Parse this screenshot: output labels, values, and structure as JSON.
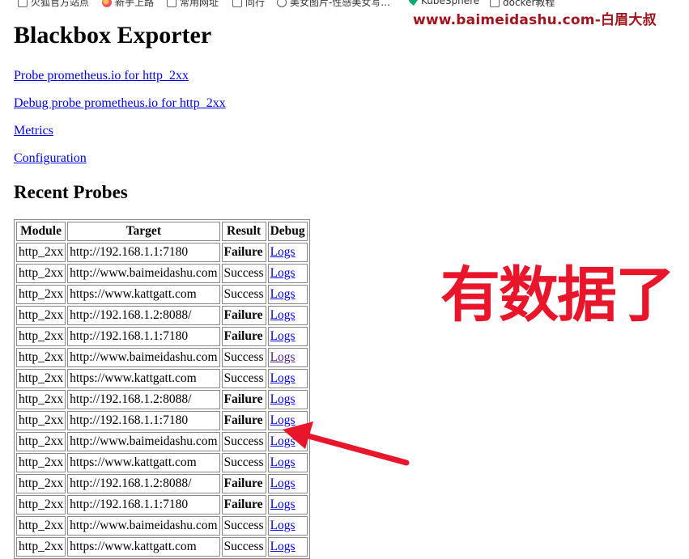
{
  "bookmarks": [
    {
      "label": "火狐官方站点",
      "icon": "bookmark-icon"
    },
    {
      "label": "新手上路",
      "icon": "firefox-icon"
    },
    {
      "label": "常用网址",
      "icon": "bookmark-icon"
    },
    {
      "label": "同行",
      "icon": "bookmark-icon"
    },
    {
      "label": "美女图片-性感美女写...",
      "icon": "globe-icon"
    },
    {
      "label": "KubeSphere",
      "icon": "kubesphere-icon"
    },
    {
      "label": "docker教程",
      "icon": "bookmark-icon"
    }
  ],
  "watermark": "www.baimeidashu.com-白眉大叔",
  "page": {
    "title": "Blackbox Exporter",
    "links": [
      "Probe prometheus.io for http_2xx",
      "Debug probe prometheus.io for http_2xx",
      "Metrics",
      "Configuration"
    ],
    "section_title": "Recent Probes"
  },
  "table": {
    "headers": [
      "Module",
      "Target",
      "Result",
      "Debug"
    ],
    "rows": [
      {
        "module": "http_2xx",
        "target": "http://192.168.1.1:7180",
        "result": "Failure",
        "debug": "Logs"
      },
      {
        "module": "http_2xx",
        "target": "http://www.baimeidashu.com",
        "result": "Success",
        "debug": "Logs"
      },
      {
        "module": "http_2xx",
        "target": "https://www.kattgatt.com",
        "result": "Success",
        "debug": "Logs"
      },
      {
        "module": "http_2xx",
        "target": "http://192.168.1.2:8088/",
        "result": "Failure",
        "debug": "Logs"
      },
      {
        "module": "http_2xx",
        "target": "http://192.168.1.1:7180",
        "result": "Failure",
        "debug": "Logs"
      },
      {
        "module": "http_2xx",
        "target": "http://www.baimeidashu.com",
        "result": "Success",
        "debug": "Logs",
        "visited": true
      },
      {
        "module": "http_2xx",
        "target": "https://www.kattgatt.com",
        "result": "Success",
        "debug": "Logs"
      },
      {
        "module": "http_2xx",
        "target": "http://192.168.1.2:8088/",
        "result": "Failure",
        "debug": "Logs"
      },
      {
        "module": "http_2xx",
        "target": "http://192.168.1.1:7180",
        "result": "Failure",
        "debug": "Logs"
      },
      {
        "module": "http_2xx",
        "target": "http://www.baimeidashu.com",
        "result": "Success",
        "debug": "Logs"
      },
      {
        "module": "http_2xx",
        "target": "https://www.kattgatt.com",
        "result": "Success",
        "debug": "Logs"
      },
      {
        "module": "http_2xx",
        "target": "http://192.168.1.2:8088/",
        "result": "Failure",
        "debug": "Logs"
      },
      {
        "module": "http_2xx",
        "target": "http://192.168.1.1:7180",
        "result": "Failure",
        "debug": "Logs"
      },
      {
        "module": "http_2xx",
        "target": "http://www.baimeidashu.com",
        "result": "Success",
        "debug": "Logs"
      },
      {
        "module": "http_2xx",
        "target": "https://www.kattgatt.com",
        "result": "Success",
        "debug": "Logs"
      }
    ]
  },
  "annotation": {
    "text": "有数据了",
    "color": "#e8152b"
  }
}
